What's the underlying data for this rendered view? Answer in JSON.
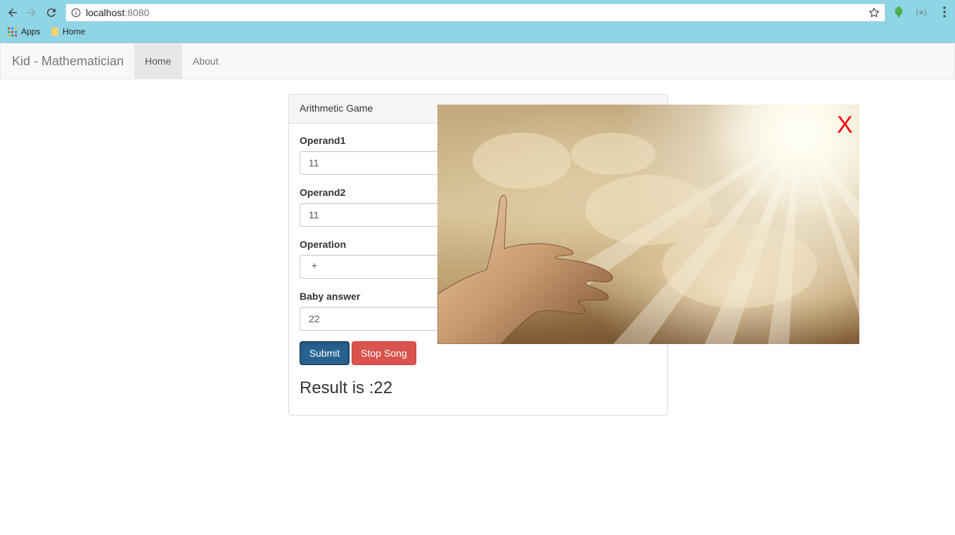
{
  "browser": {
    "url_host": "localhost",
    "url_port": ":8080",
    "bookmarks": [
      {
        "label": "Apps",
        "icon": "apps-grid-icon"
      },
      {
        "label": "Home",
        "icon": "folder-icon"
      }
    ]
  },
  "navbar": {
    "brand": "Kid - Mathematician",
    "links": [
      {
        "label": "Home",
        "active": true
      },
      {
        "label": "About",
        "active": false
      }
    ]
  },
  "panel": {
    "title": "Arithmetic Game",
    "fields": [
      {
        "label": "Operand1",
        "value": "11"
      },
      {
        "label": "Operand2",
        "value": "11"
      },
      {
        "label": "Operation",
        "value": "+"
      },
      {
        "label": "Baby answer",
        "value": "22"
      }
    ],
    "submit_label": "Submit",
    "stop_label": "Stop Song",
    "result_text": "Result is :22"
  },
  "overlay": {
    "close_label": "X",
    "close_color": "#ff0000"
  },
  "colors": {
    "chrome_bg": "#8ed5e6",
    "primary": "#286090",
    "danger": "#d9534f"
  }
}
